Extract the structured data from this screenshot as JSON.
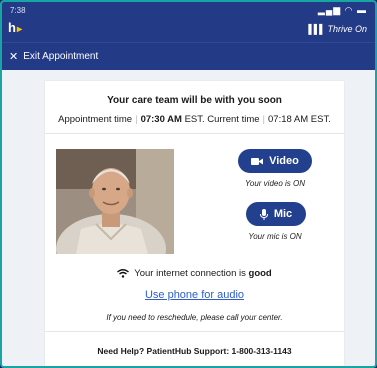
{
  "status_bar": {
    "time": "7:38",
    "icons": "▂▄▆ ◠ ▬"
  },
  "header": {
    "logo": "h",
    "brand": "Thrive On"
  },
  "exit": {
    "label": "Exit Appointment"
  },
  "card": {
    "heading": "Your care team will be with you soon",
    "appointment_label": "Appointment time",
    "appointment_time": "07:30 AM",
    "appointment_tz": "EST.",
    "current_label": "Current time",
    "current_time": "07:18 AM EST."
  },
  "controls": {
    "video_label": "Video",
    "video_state": "Your video is ON",
    "mic_label": "Mic",
    "mic_state": "Your mic is ON"
  },
  "connection": {
    "prefix": "Your internet connection is",
    "quality": "good"
  },
  "phone_link": "Use phone for audio",
  "reschedule_note": "If you need to reschedule, please call your center.",
  "help": "Need Help? PatientHub Support: 1-800-313-1143",
  "colors": {
    "header": "#233a86",
    "button": "#23408f",
    "link": "#2d5ec8",
    "border": "#1aa5a5"
  }
}
